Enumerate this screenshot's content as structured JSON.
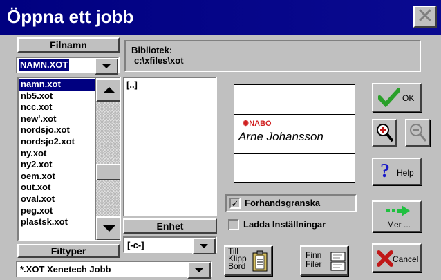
{
  "window": {
    "title": "Öppna ett jobb"
  },
  "filename": {
    "label": "Filnamn",
    "value": "NAMN.XOT",
    "files": [
      "namn.xot",
      "nb5.xot",
      "ncc.xot",
      "new'.xot",
      "nordsjo.xot",
      "nordsjo2.xot",
      "ny.xot",
      "ny2.xot",
      "oem.xot",
      "out.xot",
      "oval.xot",
      "peg.xot",
      "plastsk.xot"
    ],
    "selected_index": 0
  },
  "library": {
    "label": "Bibliotek:",
    "path": "c:\\xfiles\\xot"
  },
  "directories": [
    "[..]"
  ],
  "drive": {
    "label": "Enhet",
    "value": "[-c-]"
  },
  "filetypes": {
    "label": "Filtyper",
    "value": "*.XOT Xenetech Jobb"
  },
  "preview": {
    "brand": "NABO",
    "name": "Arne Johansson"
  },
  "options": {
    "preview_label": "Förhandsgranska",
    "preview_checked": true,
    "load_settings_label": "Ladda Inställningar",
    "load_settings_checked": false
  },
  "buttons": {
    "ok": "OK",
    "help": "Help",
    "more": "Mer ...",
    "cancel": "Cancel",
    "clipboard": "Till\nKlipp\nBord",
    "find_files": "Finn\nFiler"
  },
  "colors": {
    "title_bar": "#000080",
    "face": "#c0c0c0",
    "selection": "#000080",
    "ok_check": "#2aa02a",
    "cancel_x": "#c01818",
    "help_q": "#1818c8",
    "arrow": "#20c040",
    "brand_red": "#d02020"
  }
}
